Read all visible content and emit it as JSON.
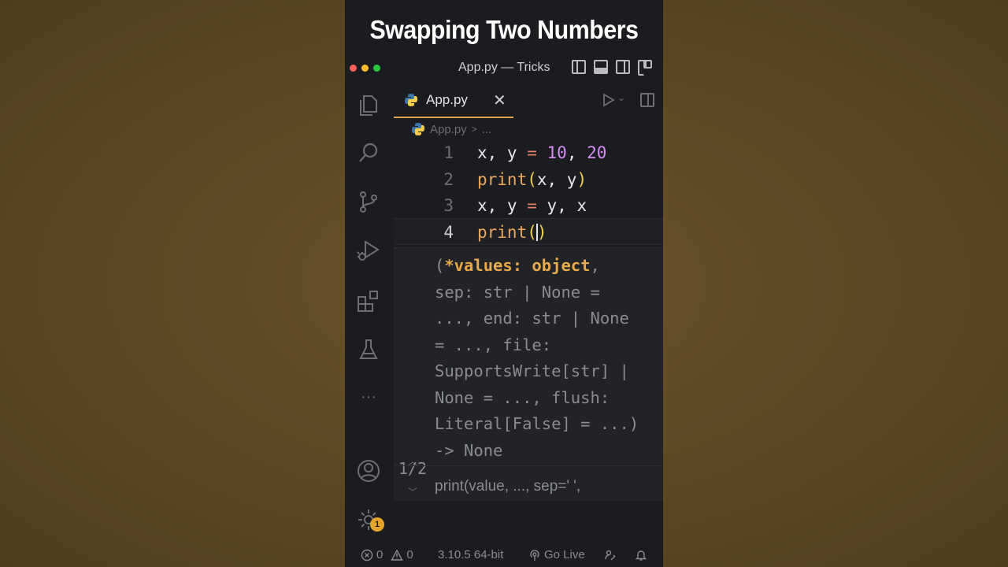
{
  "video": {
    "title": "Swapping  Two Numbers"
  },
  "window": {
    "title": "App.py — Tricks"
  },
  "tab": {
    "label": "App.py",
    "close": "✕"
  },
  "breadcrumb": {
    "file": "App.py",
    "sep": ">",
    "rest": "..."
  },
  "editor": {
    "lines": [
      {
        "num": "1"
      },
      {
        "num": "2"
      },
      {
        "num": "3"
      },
      {
        "num": "4"
      }
    ],
    "tokens": {
      "l1_a": "x, y ",
      "l1_op": "=",
      "l1_num1": "10",
      "l1_comma": ", ",
      "l1_num2": "20",
      "l2_fn": "print",
      "l2_open": "(",
      "l2_args": "x, y",
      "l2_close": ")",
      "l3_a": "x, y ",
      "l3_op": "=",
      "l3_b": " y, x",
      "l4_fn": "print",
      "l4_open": "(",
      "l4_close": ")"
    }
  },
  "signature": {
    "open": "(",
    "active": "*values: object",
    "after_active": ",",
    "lines": [
      "sep: str | None =",
      "..., end: str | None",
      "= ..., file:",
      "SupportsWrite[str] |",
      "None = ..., flush:",
      "Literal[False] = ...)",
      "-> None"
    ],
    "counter": "1/2",
    "doc": "print(value, ..., sep=' ',"
  },
  "activity_bar": {
    "items": [
      "files-icon",
      "search-icon",
      "source-control-icon",
      "run-debug-icon",
      "extensions-icon",
      "testing-icon",
      "more-icon",
      "account-icon",
      "settings-icon"
    ],
    "more_label": "···",
    "settings_badge": "1"
  },
  "statusbar": {
    "errors": "0",
    "warnings": "0",
    "interpreter": "3.10.5 64-bit",
    "go_live": "Go Live"
  }
}
